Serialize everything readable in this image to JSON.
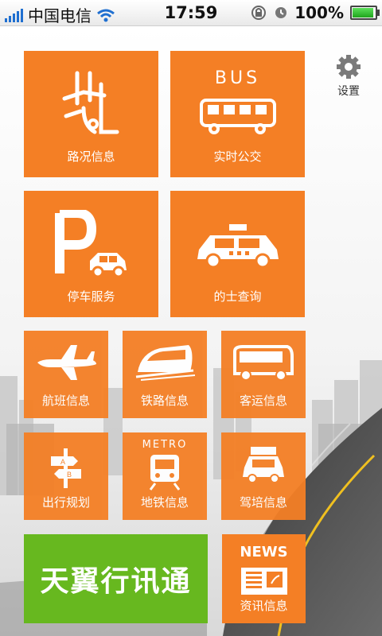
{
  "status_bar": {
    "carrier": "中国电信",
    "time": "17:59",
    "battery": "100%",
    "signal_bars": 5,
    "icons": [
      "signal-icon",
      "wifi-icon",
      "rotation-lock-icon",
      "alarm-icon",
      "battery-icon"
    ]
  },
  "settings": {
    "label": "设置",
    "icon": "gear-icon"
  },
  "tiles": {
    "road": {
      "label": "路况信息",
      "icon": "road-map-icon"
    },
    "bus": {
      "label": "实时公交",
      "icon_text": "BUS",
      "icon": "bus-icon"
    },
    "parking": {
      "label": "停车服务",
      "icon": "parking-icon"
    },
    "taxi": {
      "label": "的士查询",
      "icon": "taxi-icon"
    },
    "flight": {
      "label": "航班信息",
      "icon": "airplane-icon"
    },
    "rail": {
      "label": "铁路信息",
      "icon": "train-icon"
    },
    "coach": {
      "label": "客运信息",
      "icon": "coach-bus-icon"
    },
    "trip": {
      "label": "出行规划",
      "icon": "signpost-icon"
    },
    "metro": {
      "label": "地铁信息",
      "icon_text": "METRO",
      "icon": "metro-icon"
    },
    "driving": {
      "label": "驾培信息",
      "icon": "driving-school-car-icon"
    },
    "brand": {
      "label": "天翼行讯通"
    },
    "news": {
      "label": "资讯信息",
      "icon_text": "NEWS",
      "icon": "newspaper-icon"
    }
  },
  "colors": {
    "tile": "#f47f25",
    "brand_tile": "#67b81f"
  }
}
